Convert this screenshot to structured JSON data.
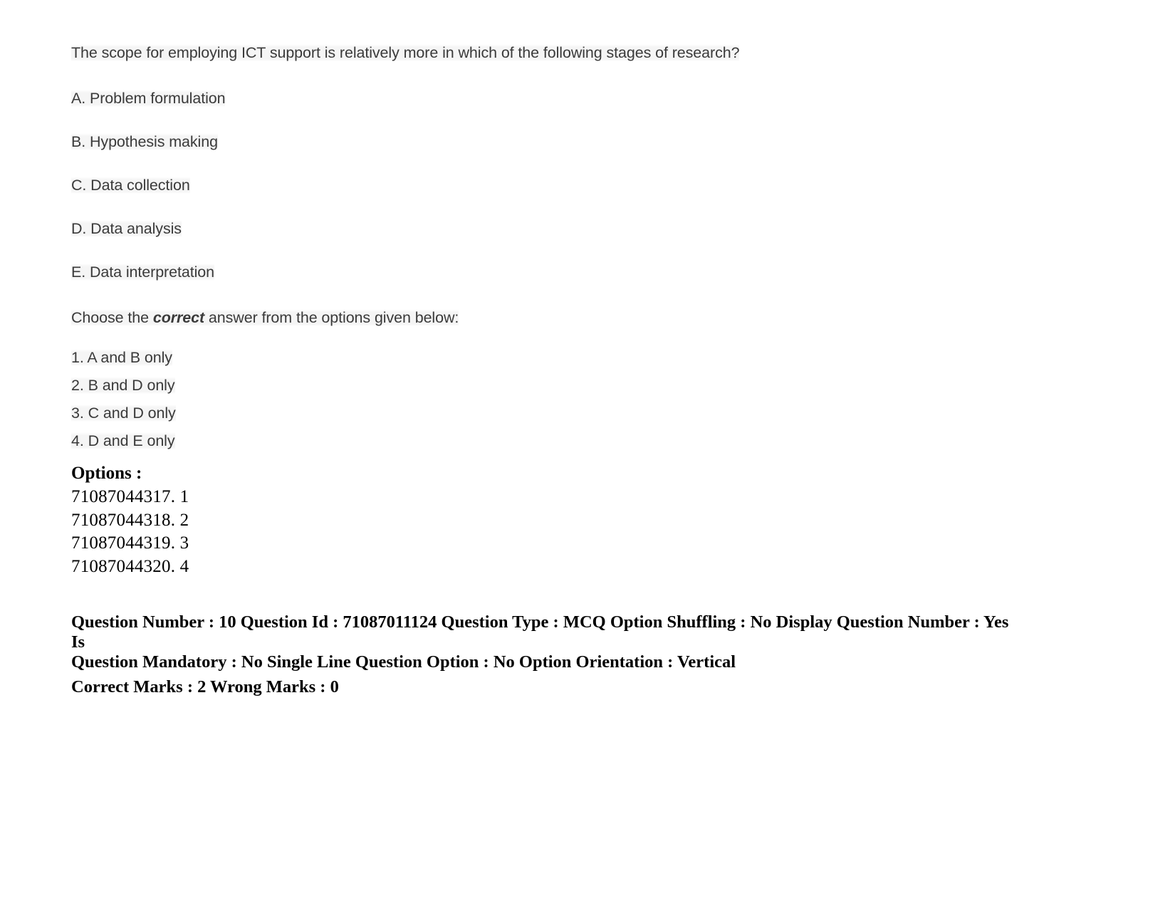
{
  "question": {
    "stem": "The scope for employing ICT support is relatively more in which of the following stages of research?",
    "statements": [
      "A. Problem formulation",
      "B. Hypothesis making",
      "C. Data collection",
      "D. Data analysis",
      "E. Data interpretation"
    ],
    "instruction": {
      "before": "Choose the ",
      "emphasis": "correct",
      "after": " answer from the options given below:"
    },
    "choices": [
      "1. A and B only",
      "2. B and D only",
      "3. C and D only",
      "4. D and E only"
    ]
  },
  "options_section": {
    "heading": "Options :",
    "items": [
      "71087044317. 1",
      "71087044318. 2",
      "71087044319. 3",
      "71087044320. 4"
    ]
  },
  "metadata": {
    "line1": "Question Number : 10 Question Id : 71087011124 Question Type : MCQ Option Shuffling : No Display Question Number : Yes Is",
    "line2": "Question Mandatory : No Single Line Question Option : No Option Orientation : Vertical",
    "line3": "Correct Marks : 2 Wrong Marks : 0"
  }
}
